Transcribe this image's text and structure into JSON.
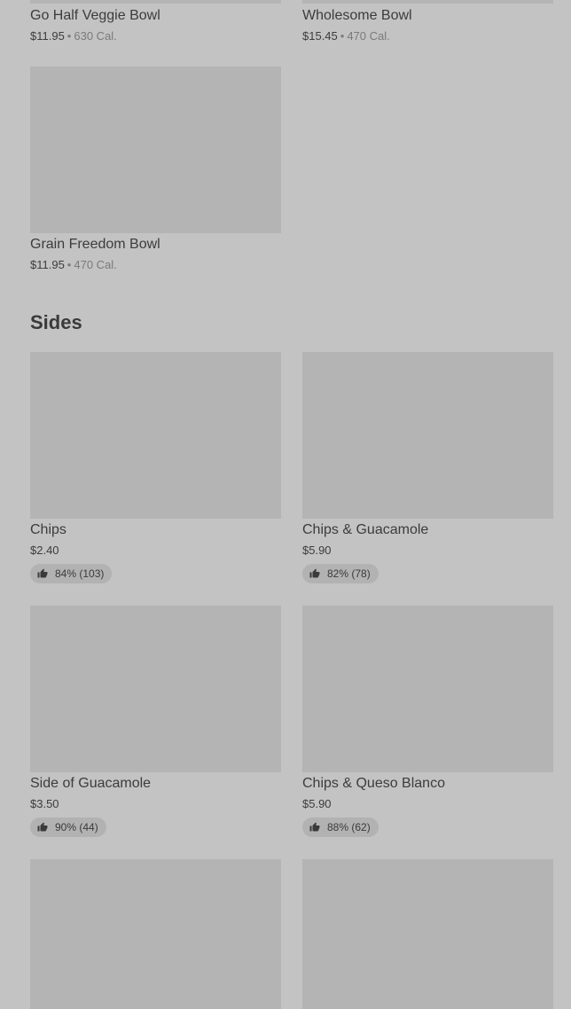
{
  "bowls": [
    {
      "name": "Go Half Veggie Bowl",
      "price": "$11.95",
      "calories": "630 Cal."
    },
    {
      "name": "Wholesome Bowl",
      "price": "$15.45",
      "calories": "470 Cal."
    },
    {
      "name": "Grain Freedom Bowl",
      "price": "$11.95",
      "calories": "470 Cal."
    }
  ],
  "sides": {
    "title": "Sides",
    "items": [
      {
        "name": "Chips",
        "price": "$2.40",
        "rating": "84% (103)"
      },
      {
        "name": "Chips & Guacamole",
        "price": "$5.90",
        "rating": "82% (78)"
      },
      {
        "name": "Side of Guacamole",
        "price": "$3.50",
        "rating": "90% (44)"
      },
      {
        "name": "Chips & Queso Blanco",
        "price": "$5.90",
        "rating": "88% (62)"
      }
    ]
  },
  "separator": "•",
  "icons": {
    "rating": "thumbs-up-icon"
  },
  "colors": {
    "background": "#c3c3c3",
    "placeholder": "#b4b4b4",
    "badge": "#b2b2b2"
  }
}
